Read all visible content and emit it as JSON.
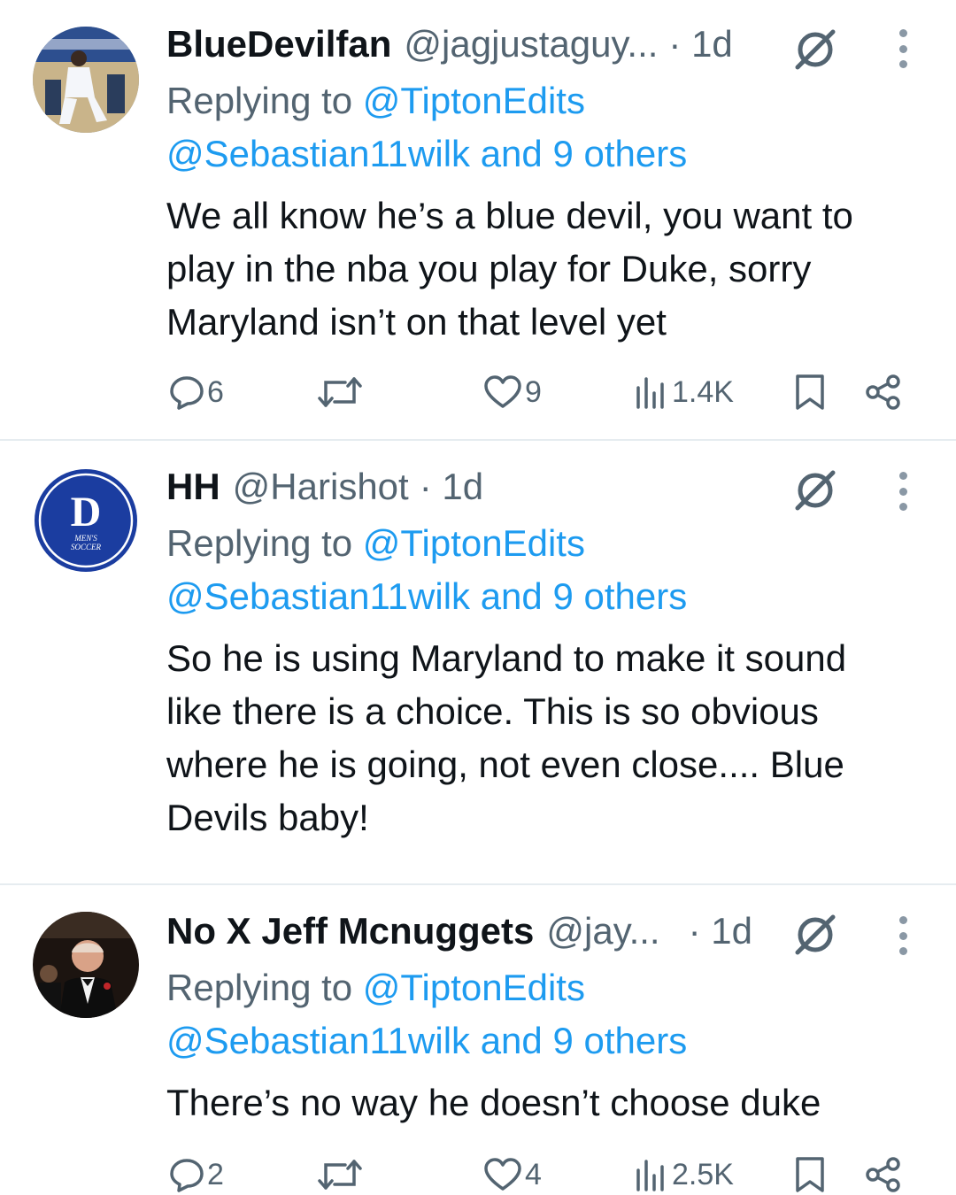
{
  "tweets": [
    {
      "name": "BlueDevilfan",
      "handle": "@jagjustaguy...",
      "time": "· 1d",
      "replying_prefix": "Replying to ",
      "replying_to": "@TiptonEdits",
      "mentions": "@Sebastian11wilk and 9 others",
      "body": [
        "We all know he’s a blue devil, you want to",
        "play in the nba you play for Duke, sorry",
        "Maryland isn’t on that level yet"
      ],
      "replies": "6",
      "reposts": "",
      "likes": "9",
      "views": "1.4K"
    },
    {
      "name": "HH",
      "handle": "@Harishot",
      "time": "· 1d",
      "replying_prefix": "Replying to ",
      "replying_to": "@TiptonEdits",
      "mentions": "@Sebastian11wilk and 9 others",
      "body": [
        "So he is using Maryland to make it sound",
        "like there is a choice. This is so obvious",
        "where he is going, not even close.... Blue",
        "Devils baby!"
      ],
      "avatar_logo_text": "D",
      "avatar_caption_1": "MEN'S",
      "avatar_caption_2": "SOCCER"
    },
    {
      "name": "No X Jeff Mcnuggets",
      "handle": "@jay...",
      "time": "· 1d",
      "replying_prefix": "Replying to ",
      "replying_to": "@TiptonEdits",
      "mentions": "@Sebastian11wilk and 9 others",
      "body": [
        "There’s no way he doesn’t choose duke"
      ],
      "replies": "2",
      "reposts": "",
      "likes": "4",
      "views": "2.5K"
    }
  ],
  "icons": {
    "reply": "reply-icon",
    "repost": "repost-icon",
    "like": "heart-icon",
    "views": "views-icon",
    "bookmark": "bookmark-icon",
    "share": "share-icon",
    "grok": "grok-icon",
    "more": "more-icon"
  },
  "colors": {
    "link": "#1d9bf0",
    "secondary": "#536471",
    "text": "#0f1419",
    "duke_blue": "#1b3da0"
  }
}
